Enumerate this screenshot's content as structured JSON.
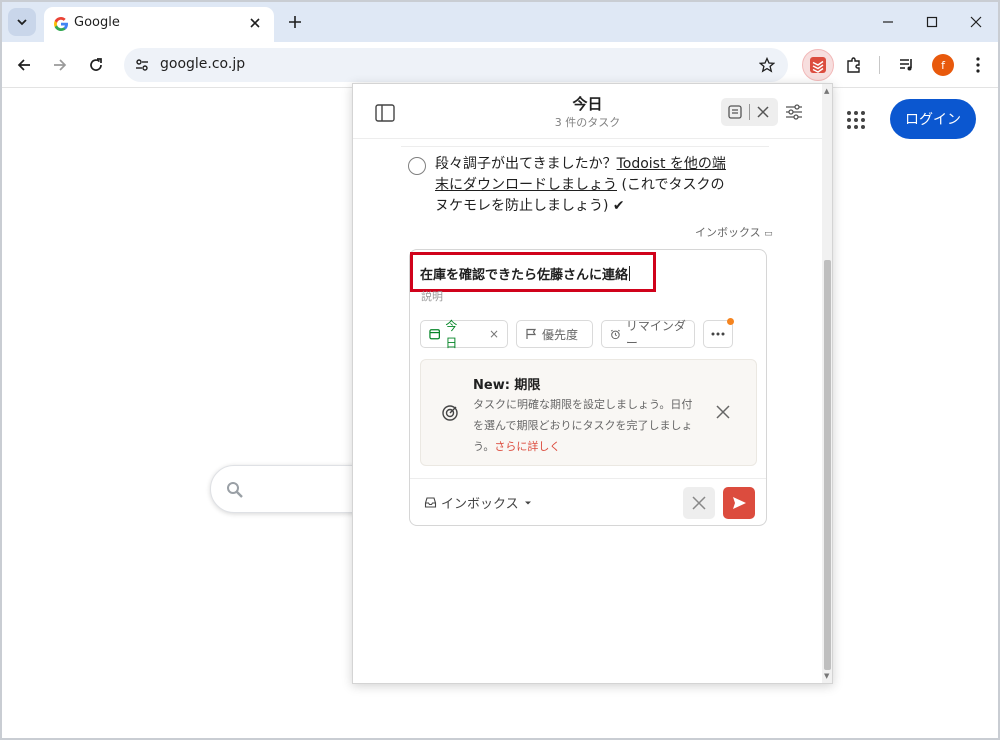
{
  "browser": {
    "tab_title": "Google",
    "url": "google.co.jp",
    "profile_initial": "f"
  },
  "google": {
    "login_label": "ログイン"
  },
  "todoist": {
    "title": "今日",
    "subtitle": "3 件のタスク",
    "task": {
      "text_before": "段々調子が出てきましたか？",
      "link_text": "Todoist を他の端末にダウンロードしましょう",
      "text_after": " (これでタスクのヌケモレを防止しましょう) ✔"
    },
    "task_project": "インボックス",
    "editor": {
      "task_name": "在庫を確認できたら佐藤さんに連絡",
      "description_placeholder": "説明",
      "chip_today": "今日",
      "chip_priority": "優先度",
      "chip_reminder": "リマインダー",
      "promo_title": "New: 期限",
      "promo_body": "タスクに明確な期限を設定しましょう。日付を選んで期限どおりにタスクを完了しましょう。",
      "promo_link": "さらに詳しく",
      "project": "インボックス"
    }
  },
  "colors": {
    "accent": "#dc4c3e",
    "today_green": "#058527",
    "google_blue": "#0b57d0",
    "highlight_red": "#d0021b"
  }
}
